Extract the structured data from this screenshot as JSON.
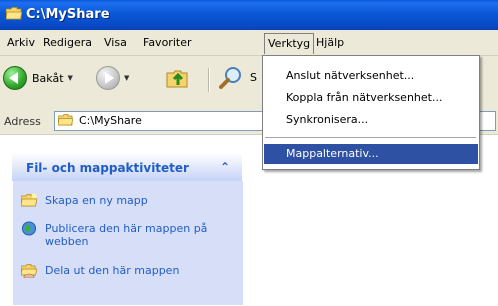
{
  "window": {
    "title": "C:\\MyShare"
  },
  "menubar": {
    "items": [
      "Arkiv",
      "Redigera",
      "Visa",
      "Favoriter",
      "Verktyg",
      "Hjälp"
    ]
  },
  "toolbar": {
    "back_label": "Bakåt",
    "search_label": "S"
  },
  "address": {
    "label": "Adress",
    "value": "C:\\MyShare"
  },
  "taskpane": {
    "title": "Fil- och mappaktiviteter",
    "collapse_glyph": "⌃",
    "tasks": [
      {
        "label": "Skapa en ny mapp",
        "icon": "new-folder-icon"
      },
      {
        "label": "Publicera den här mappen på webben",
        "icon": "publish-web-icon"
      },
      {
        "label": "Dela ut den här mappen",
        "icon": "share-folder-icon"
      }
    ]
  },
  "tools_menu": {
    "items": [
      "Anslut nätverksenhet...",
      "Koppla från nätverksenhet...",
      "Synkronisera...",
      "Mappalternativ..."
    ],
    "selected": "Mappalternativ..."
  }
}
